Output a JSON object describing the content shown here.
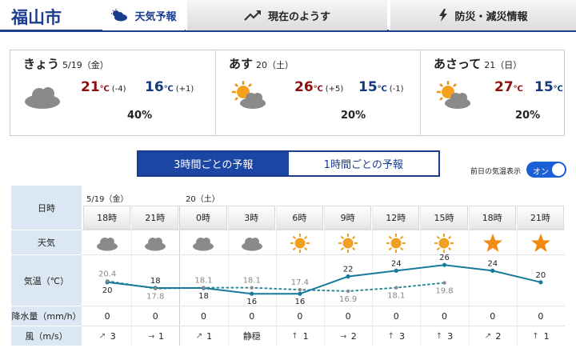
{
  "header": {
    "city": "福山市",
    "tabs": [
      {
        "label": "天気予報",
        "icon": "weather-icon",
        "active": true
      },
      {
        "label": "現在のようす",
        "icon": "trend-icon",
        "active": false
      },
      {
        "label": "防災・減災情報",
        "icon": "lightning-icon",
        "active": false
      }
    ]
  },
  "days": [
    {
      "name": "きょう",
      "date": "5/19（金）",
      "icon": "cloudy",
      "high": "21",
      "high_diff": "(-4)",
      "low": "16",
      "low_diff": "(+1)",
      "rain": "40%"
    },
    {
      "name": "あす",
      "date": "20（土）",
      "icon": "sunny-cloudy",
      "high": "26",
      "high_diff": "(+5)",
      "low": "15",
      "low_diff": "(-1)",
      "rain": "20%"
    },
    {
      "name": "あさって",
      "date": "21（日）",
      "icon": "sunny-cloudy",
      "high": "27",
      "high_diff": "",
      "low": "15",
      "low_diff": "",
      "rain": "20%"
    }
  ],
  "temp_unit": "℃",
  "toggle": {
    "three_hour": "3時間ごとの予報",
    "one_hour": "1時間ごとの予報"
  },
  "prev_day": {
    "label": "前日の気温表示",
    "switch": "オン"
  },
  "table": {
    "labels": {
      "time": "日時",
      "weather": "天気",
      "temp": "気温（℃）",
      "rain": "降水量（mm/h）",
      "wind": "風（m/s）"
    },
    "dates": [
      "5/19（金）",
      "20（土）"
    ],
    "slots": [
      {
        "time": "18時",
        "weather": "cloudy",
        "temp": 20,
        "prev": 20.4,
        "rain": "0",
        "wind": "3",
        "wind_dir": "sw"
      },
      {
        "time": "21時",
        "weather": "cloudy",
        "temp": 18,
        "prev": 17.8,
        "rain": "0",
        "wind": "1",
        "wind_dir": "w"
      },
      {
        "time": "0時",
        "weather": "cloudy",
        "temp": 18,
        "prev": 18.1,
        "rain": "0",
        "wind": "1",
        "wind_dir": "sw"
      },
      {
        "time": "3時",
        "weather": "cloudy",
        "temp": 16,
        "prev": 18.1,
        "rain": "0",
        "wind": "静穏",
        "wind_dir": ""
      },
      {
        "time": "6時",
        "weather": "sunny",
        "temp": 16,
        "prev": 17.4,
        "rain": "0",
        "wind": "1",
        "wind_dir": "s"
      },
      {
        "time": "9時",
        "weather": "sunny",
        "temp": 22,
        "prev": 16.9,
        "rain": "0",
        "wind": "2",
        "wind_dir": "w"
      },
      {
        "time": "12時",
        "weather": "sunny",
        "temp": 24,
        "prev": 18.1,
        "rain": "0",
        "wind": "3",
        "wind_dir": "s"
      },
      {
        "time": "15時",
        "weather": "sunny",
        "temp": 26,
        "prev": 19.8,
        "rain": "0",
        "wind": "3",
        "wind_dir": "s"
      },
      {
        "time": "18時",
        "weather": "clear-night",
        "temp": 24,
        "prev": null,
        "rain": "0",
        "wind": "2",
        "wind_dir": "sw"
      },
      {
        "time": "21時",
        "weather": "clear-night",
        "temp": 20,
        "prev": null,
        "rain": "0",
        "wind": "1",
        "wind_dir": "s"
      }
    ]
  },
  "chart_data": {
    "type": "line",
    "x": [
      "18時",
      "21時",
      "0時",
      "3時",
      "6時",
      "9時",
      "12時",
      "15時",
      "18時",
      "21時"
    ],
    "series": [
      {
        "values": [
          20,
          18,
          18,
          16,
          16,
          22,
          24,
          26,
          24,
          20
        ]
      },
      {
        "values": [
          20.4,
          17.8,
          18.1,
          18.1,
          17.4,
          16.9,
          18.1,
          19.8,
          null,
          null
        ]
      }
    ],
    "ylim": [
      13,
      28
    ]
  },
  "colors": {
    "brand": "#1b3d8f",
    "high": "#8c1010",
    "low": "#123a7a",
    "line": "#167a9a",
    "prev": "#2a8a9a",
    "sun": "#f0a020",
    "star": "#f08a10"
  }
}
